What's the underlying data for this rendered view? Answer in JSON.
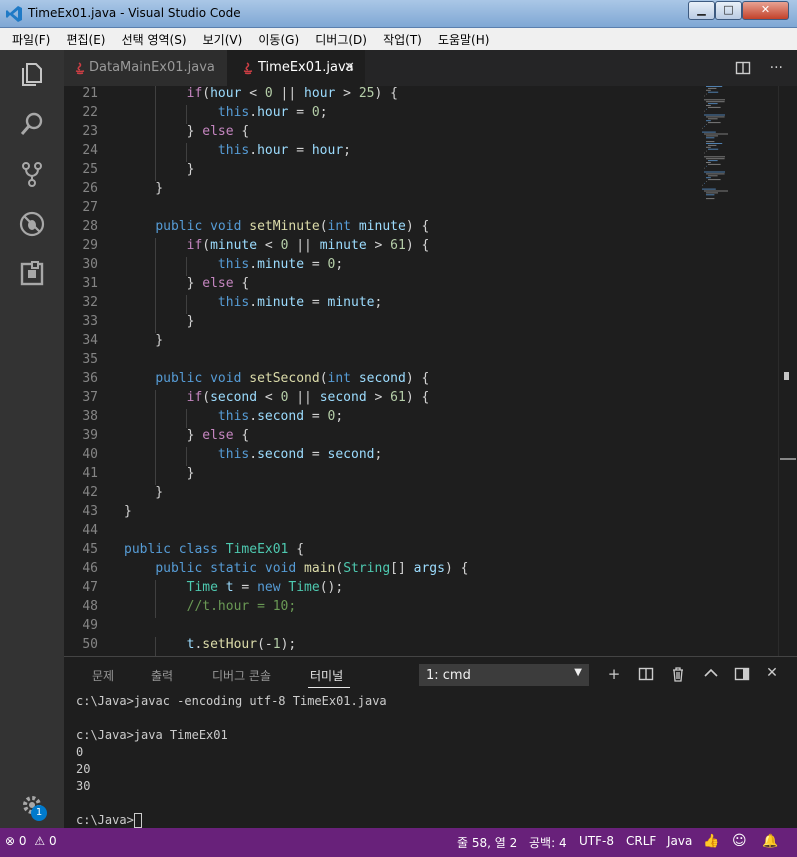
{
  "window": {
    "title": "TimeEx01.java - Visual Studio Code",
    "min_label": "▁",
    "max_label": "□",
    "close_label": "✕"
  },
  "menu": [
    "파일(F)",
    "편집(E)",
    "선택 영역(S)",
    "보기(V)",
    "이동(G)",
    "디버그(D)",
    "작업(T)",
    "도움말(H)"
  ],
  "tabs": [
    {
      "label": "DataMainEx01.java",
      "active": false
    },
    {
      "label": "TimeEx01.java",
      "active": true
    }
  ],
  "tab_close": "✕",
  "tab_actions": {
    "split": "split-editor-icon",
    "more": "···"
  },
  "activity_icons": [
    "explorer-icon",
    "search-icon",
    "source-control-icon",
    "debug-icon",
    "extensions-icon"
  ],
  "line_numbers": [
    "21",
    "22",
    "23",
    "24",
    "25",
    "26",
    "27",
    "28",
    "29",
    "30",
    "31",
    "32",
    "33",
    "34",
    "35",
    "36",
    "37",
    "38",
    "39",
    "40",
    "41",
    "42",
    "43",
    "44",
    "45",
    "46",
    "47",
    "48",
    "49",
    "50"
  ],
  "code_lines": [
    "        if(hour < 0 || hour > 25) {",
    "            this.hour = 0;",
    "        } else {",
    "            this.hour = hour;",
    "        }",
    "    }",
    "",
    "    public void setMinute(int minute) {",
    "        if(minute < 0 || minute > 61) {",
    "            this.minute = 0;",
    "        } else {",
    "            this.minute = minute;",
    "        }",
    "    }",
    "",
    "    public void setSecond(int second) {",
    "        if(second < 0 || second > 61) {",
    "            this.second = 0;",
    "        } else {",
    "            this.second = second;",
    "        }",
    "    }",
    "}",
    "",
    "public class TimeEx01 {",
    "    public static void main(String[] args) {",
    "        Time t = new Time();",
    "        //t.hour = 10;",
    "",
    "        t.setHour(-1);"
  ],
  "panel": {
    "tabs": [
      "문제",
      "출력",
      "디버그 콘솔",
      "터미널"
    ],
    "active_tab": "터미널",
    "terminal_select": "1: cmd",
    "actions": {
      "add": "+",
      "split": "split-terminal-icon",
      "kill": "trash-icon",
      "maximize": "^",
      "toggle": "panel-layout-icon",
      "close": "✕"
    },
    "terminal_lines": [
      "c:\\Java>javac -encoding utf-8 TimeEx01.java",
      "",
      "c:\\Java>java TimeEx01",
      "0",
      "20",
      "30",
      "",
      "c:\\Java>"
    ]
  },
  "status": {
    "errors": "0",
    "warnings": "0",
    "position": "줄 58, 열 2",
    "spaces": "공백: 4",
    "encoding": "UTF-8",
    "eol": "CRLF",
    "language": "Java"
  },
  "settings_badge": "1",
  "colors": {
    "statusbar": "#68217a",
    "editor_bg": "#1e1e1e",
    "activity_bg": "#333333",
    "badge": "#007acc"
  }
}
